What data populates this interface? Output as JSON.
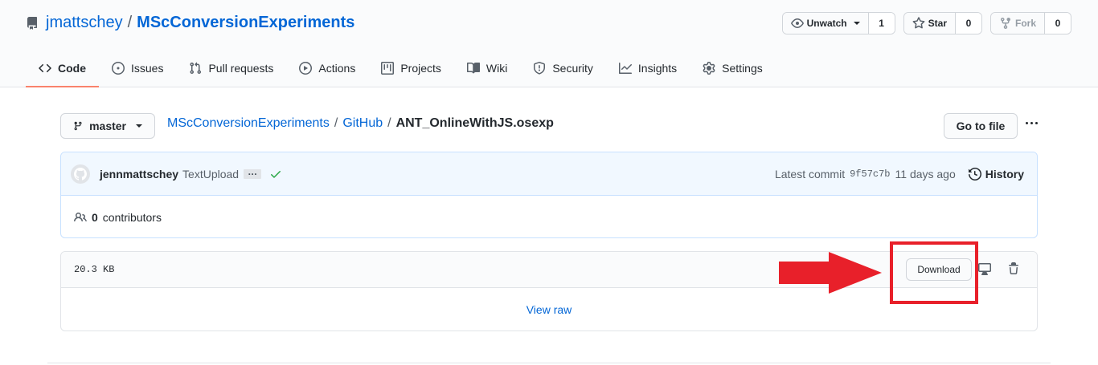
{
  "repo": {
    "owner": "jmattschey",
    "separator": "/",
    "name": "MScConversionExperiments"
  },
  "actions": [
    {
      "label": "Unwatch",
      "count": "1",
      "icon": "eye-icon",
      "has_caret": true,
      "disabled": false
    },
    {
      "label": "Star",
      "count": "0",
      "icon": "star-icon",
      "has_caret": false,
      "disabled": false
    },
    {
      "label": "Fork",
      "count": "0",
      "icon": "fork-icon",
      "has_caret": false,
      "disabled": true
    }
  ],
  "nav": [
    {
      "label": "Code",
      "icon": "code-icon",
      "selected": true
    },
    {
      "label": "Issues",
      "icon": "issue-icon"
    },
    {
      "label": "Pull requests",
      "icon": "pull-request-icon"
    },
    {
      "label": "Actions",
      "icon": "play-icon"
    },
    {
      "label": "Projects",
      "icon": "project-icon"
    },
    {
      "label": "Wiki",
      "icon": "book-icon"
    },
    {
      "label": "Security",
      "icon": "shield-icon"
    },
    {
      "label": "Insights",
      "icon": "graph-icon"
    },
    {
      "label": "Settings",
      "icon": "gear-icon"
    }
  ],
  "branch": {
    "label": "master",
    "icon": "branch-icon"
  },
  "breadcrumb": {
    "root": "MScConversionExperiments",
    "sep": "/",
    "folder": "GitHub",
    "file": "ANT_OnlineWithJS.osexp"
  },
  "goto_file": "Go to file",
  "commit": {
    "author": "jennmattschey",
    "message": "TextUpload",
    "ellipsis": "…",
    "latest_label": "Latest commit",
    "sha": "9f57c7b",
    "age": "11 days ago",
    "history": "History",
    "contributors_count": "0",
    "contributors_label": "contributors"
  },
  "file": {
    "size": "20.3 KB",
    "download": "Download",
    "view_raw": "View raw"
  },
  "annotation": {
    "color": "#e8202a"
  },
  "colors": {
    "link": "#0366d6",
    "accent_underline": "#f9826c",
    "commit_bg": "#f1f8ff",
    "success": "#28a745"
  }
}
